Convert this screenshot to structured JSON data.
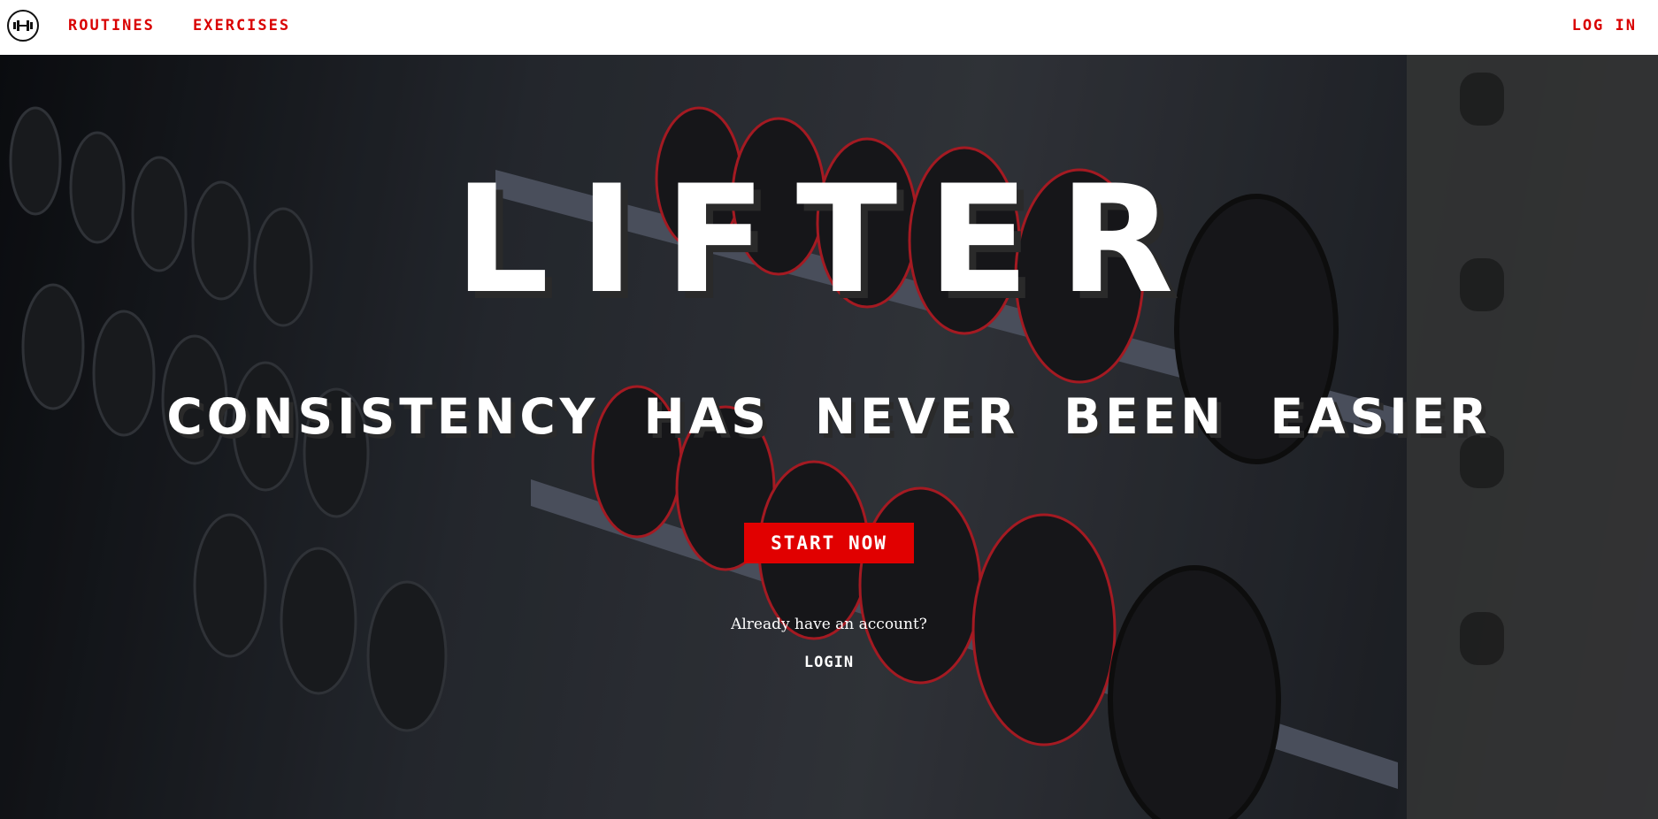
{
  "nav": {
    "logo_icon": "dumbbell-icon",
    "links": [
      "ROUTINES",
      "EXERCISES"
    ],
    "login_label": "LOG IN"
  },
  "hero": {
    "title": "LIFTER",
    "subtitle": "CONSISTENCY HAS NEVER BEEN EASIER",
    "cta_label": "START NOW",
    "account_prompt": "Already have an account?",
    "login_label": "LOGIN",
    "background_image": "gym-dumbbell-rack-photo"
  },
  "colors": {
    "accent": "#d90000",
    "button": "#e10000",
    "text_light": "#ffffff"
  }
}
